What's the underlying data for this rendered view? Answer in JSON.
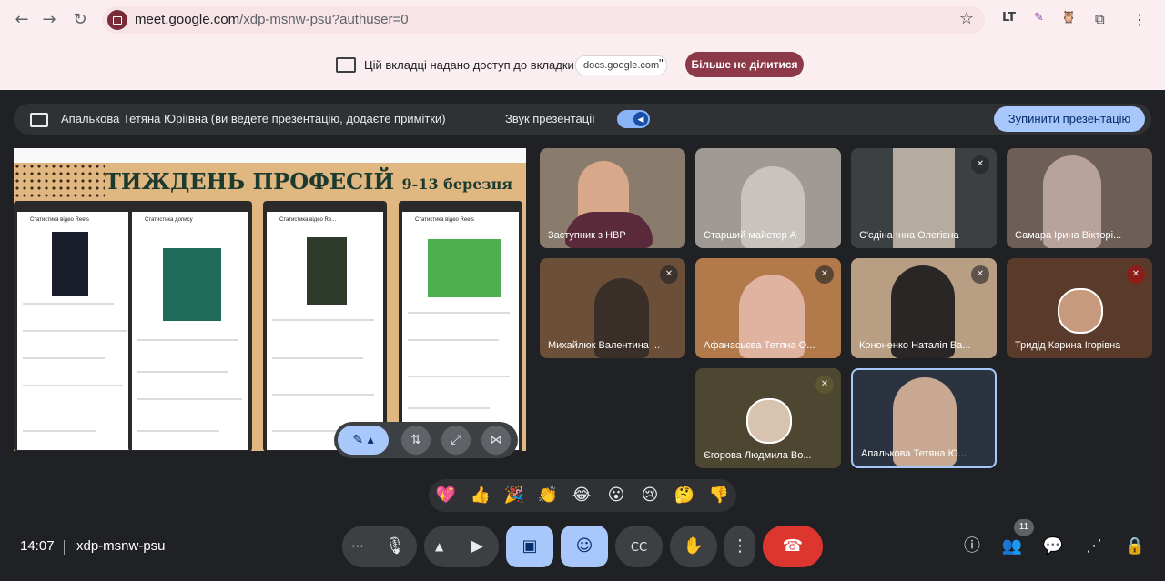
{
  "browser": {
    "url_host": "meet.google.com",
    "url_path": "/xdp-msnw-psu?authuser=0",
    "back_icon": "arrow-left-icon",
    "forward_icon": "arrow-right-icon",
    "reload_icon": "reload-icon",
    "star_icon": "star-icon",
    "extensions": [
      {
        "name": "translate-extension-icon",
        "glyph": "LT"
      },
      {
        "name": "pen-extension-icon",
        "glyph": "✎"
      },
      {
        "name": "owl-extension-icon",
        "glyph": "🦉"
      },
      {
        "name": "puzzle-extension-icon",
        "glyph": "⧉"
      },
      {
        "name": "menu-kebab-icon",
        "glyph": "⋮"
      }
    ]
  },
  "share_notice": {
    "text": "Цій вкладці надано доступ до вкладки \"",
    "chip": "docs.google.com",
    "close_quote": "\"",
    "stop_label": "Більше не ділитися"
  },
  "presenting": {
    "text": "Апалькова Тетяна Юріївна (ви ведете презентацію, додаєте примітки)",
    "sound_label": "Звук презентації",
    "stop_label": "Зупинити презентацію"
  },
  "slide": {
    "title": "ТИЖДЕНЬ ПРОФЕСІЙ",
    "dates": "9-13 березня",
    "phones": [
      {
        "title": "Статистика відео Reels"
      },
      {
        "title": "Статистика допису"
      },
      {
        "title": "Статистика відео Re..."
      },
      {
        "title": "Статистика відео Reels"
      }
    ]
  },
  "participants": [
    {
      "name": "Заступник з НВР",
      "muted": false
    },
    {
      "name": "Старший майстер А",
      "muted": false
    },
    {
      "name": "С'єдіна Інна Олегівна",
      "muted": true
    },
    {
      "name": "Самара Ірина Вікторі...",
      "muted": false
    },
    {
      "name": "Михайлюк Валентина ...",
      "muted": true
    },
    {
      "name": "Афанасьєва Тетяна О...",
      "muted": true
    },
    {
      "name": "Кононенко Наталія Ва...",
      "muted": true
    },
    {
      "name": "Тридід Карина Ігорівна",
      "muted": true
    },
    {
      "name": "Єгорова Людмила Во...",
      "muted": true
    },
    {
      "name": "Апалькова Тетяна Ю...",
      "muted": false
    }
  ],
  "reactions": [
    "💖",
    "👍",
    "🎉",
    "👏",
    "😂",
    "😮",
    "😢",
    "🤔",
    "👎"
  ],
  "footer": {
    "time": "14:07",
    "meeting_code": "xdp-msnw-psu",
    "participants_count": "11"
  },
  "colors": {
    "accent_blue": "#a8c7fa",
    "hangup_red": "#dc362e",
    "slide_beige": "#e0b780"
  }
}
